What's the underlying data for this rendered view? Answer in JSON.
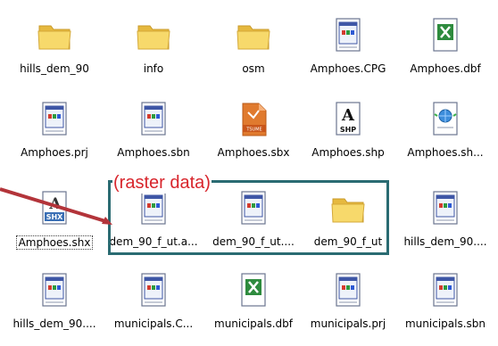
{
  "colors": {
    "folder": "#f7d96b",
    "annotation_text": "#d8252c",
    "highlight_border": "#2a6b72",
    "arrow": "#b3343a"
  },
  "files": [
    {
      "label": "hills_dem_90",
      "icon": "folder-icon"
    },
    {
      "label": "info",
      "icon": "folder-icon"
    },
    {
      "label": "osm",
      "icon": "folder-icon"
    },
    {
      "label": "Amphoes.CPG",
      "icon": "document-app-icon"
    },
    {
      "label": "Amphoes.dbf",
      "icon": "excel-icon"
    },
    {
      "label": "Amphoes.prj",
      "icon": "document-app-icon"
    },
    {
      "label": "Amphoes.sbn",
      "icon": "document-app-icon"
    },
    {
      "label": "Amphoes.sbx",
      "icon": "tsume-icon"
    },
    {
      "label": "Amphoes.shp",
      "icon": "shp-icon"
    },
    {
      "label": "Amphoes.sh...",
      "icon": "web-document-icon"
    },
    {
      "label": "Amphoes.shx",
      "icon": "shx-icon"
    },
    {
      "label": "dem_90_f_ut.a...",
      "icon": "document-app-icon"
    },
    {
      "label": "dem_90_f_ut....",
      "icon": "document-app-icon"
    },
    {
      "label": "dem_90_f_ut",
      "icon": "folder-icon"
    },
    {
      "label": "hills_dem_90....",
      "icon": "document-app-icon"
    },
    {
      "label": "hills_dem_90....",
      "icon": "document-app-icon"
    },
    {
      "label": "municipals.C...",
      "icon": "document-app-icon"
    },
    {
      "label": "municipals.dbf",
      "icon": "excel-icon"
    },
    {
      "label": "municipals.prj",
      "icon": "document-app-icon"
    },
    {
      "label": "municipals.sbn",
      "icon": "document-app-icon"
    }
  ],
  "annotation": {
    "text": "(raster data)"
  },
  "icon_text": {
    "tsume": "TSUME",
    "shp": "SHP",
    "shx": "SHX",
    "shp_glyph": "A",
    "shx_glyph": "A"
  }
}
